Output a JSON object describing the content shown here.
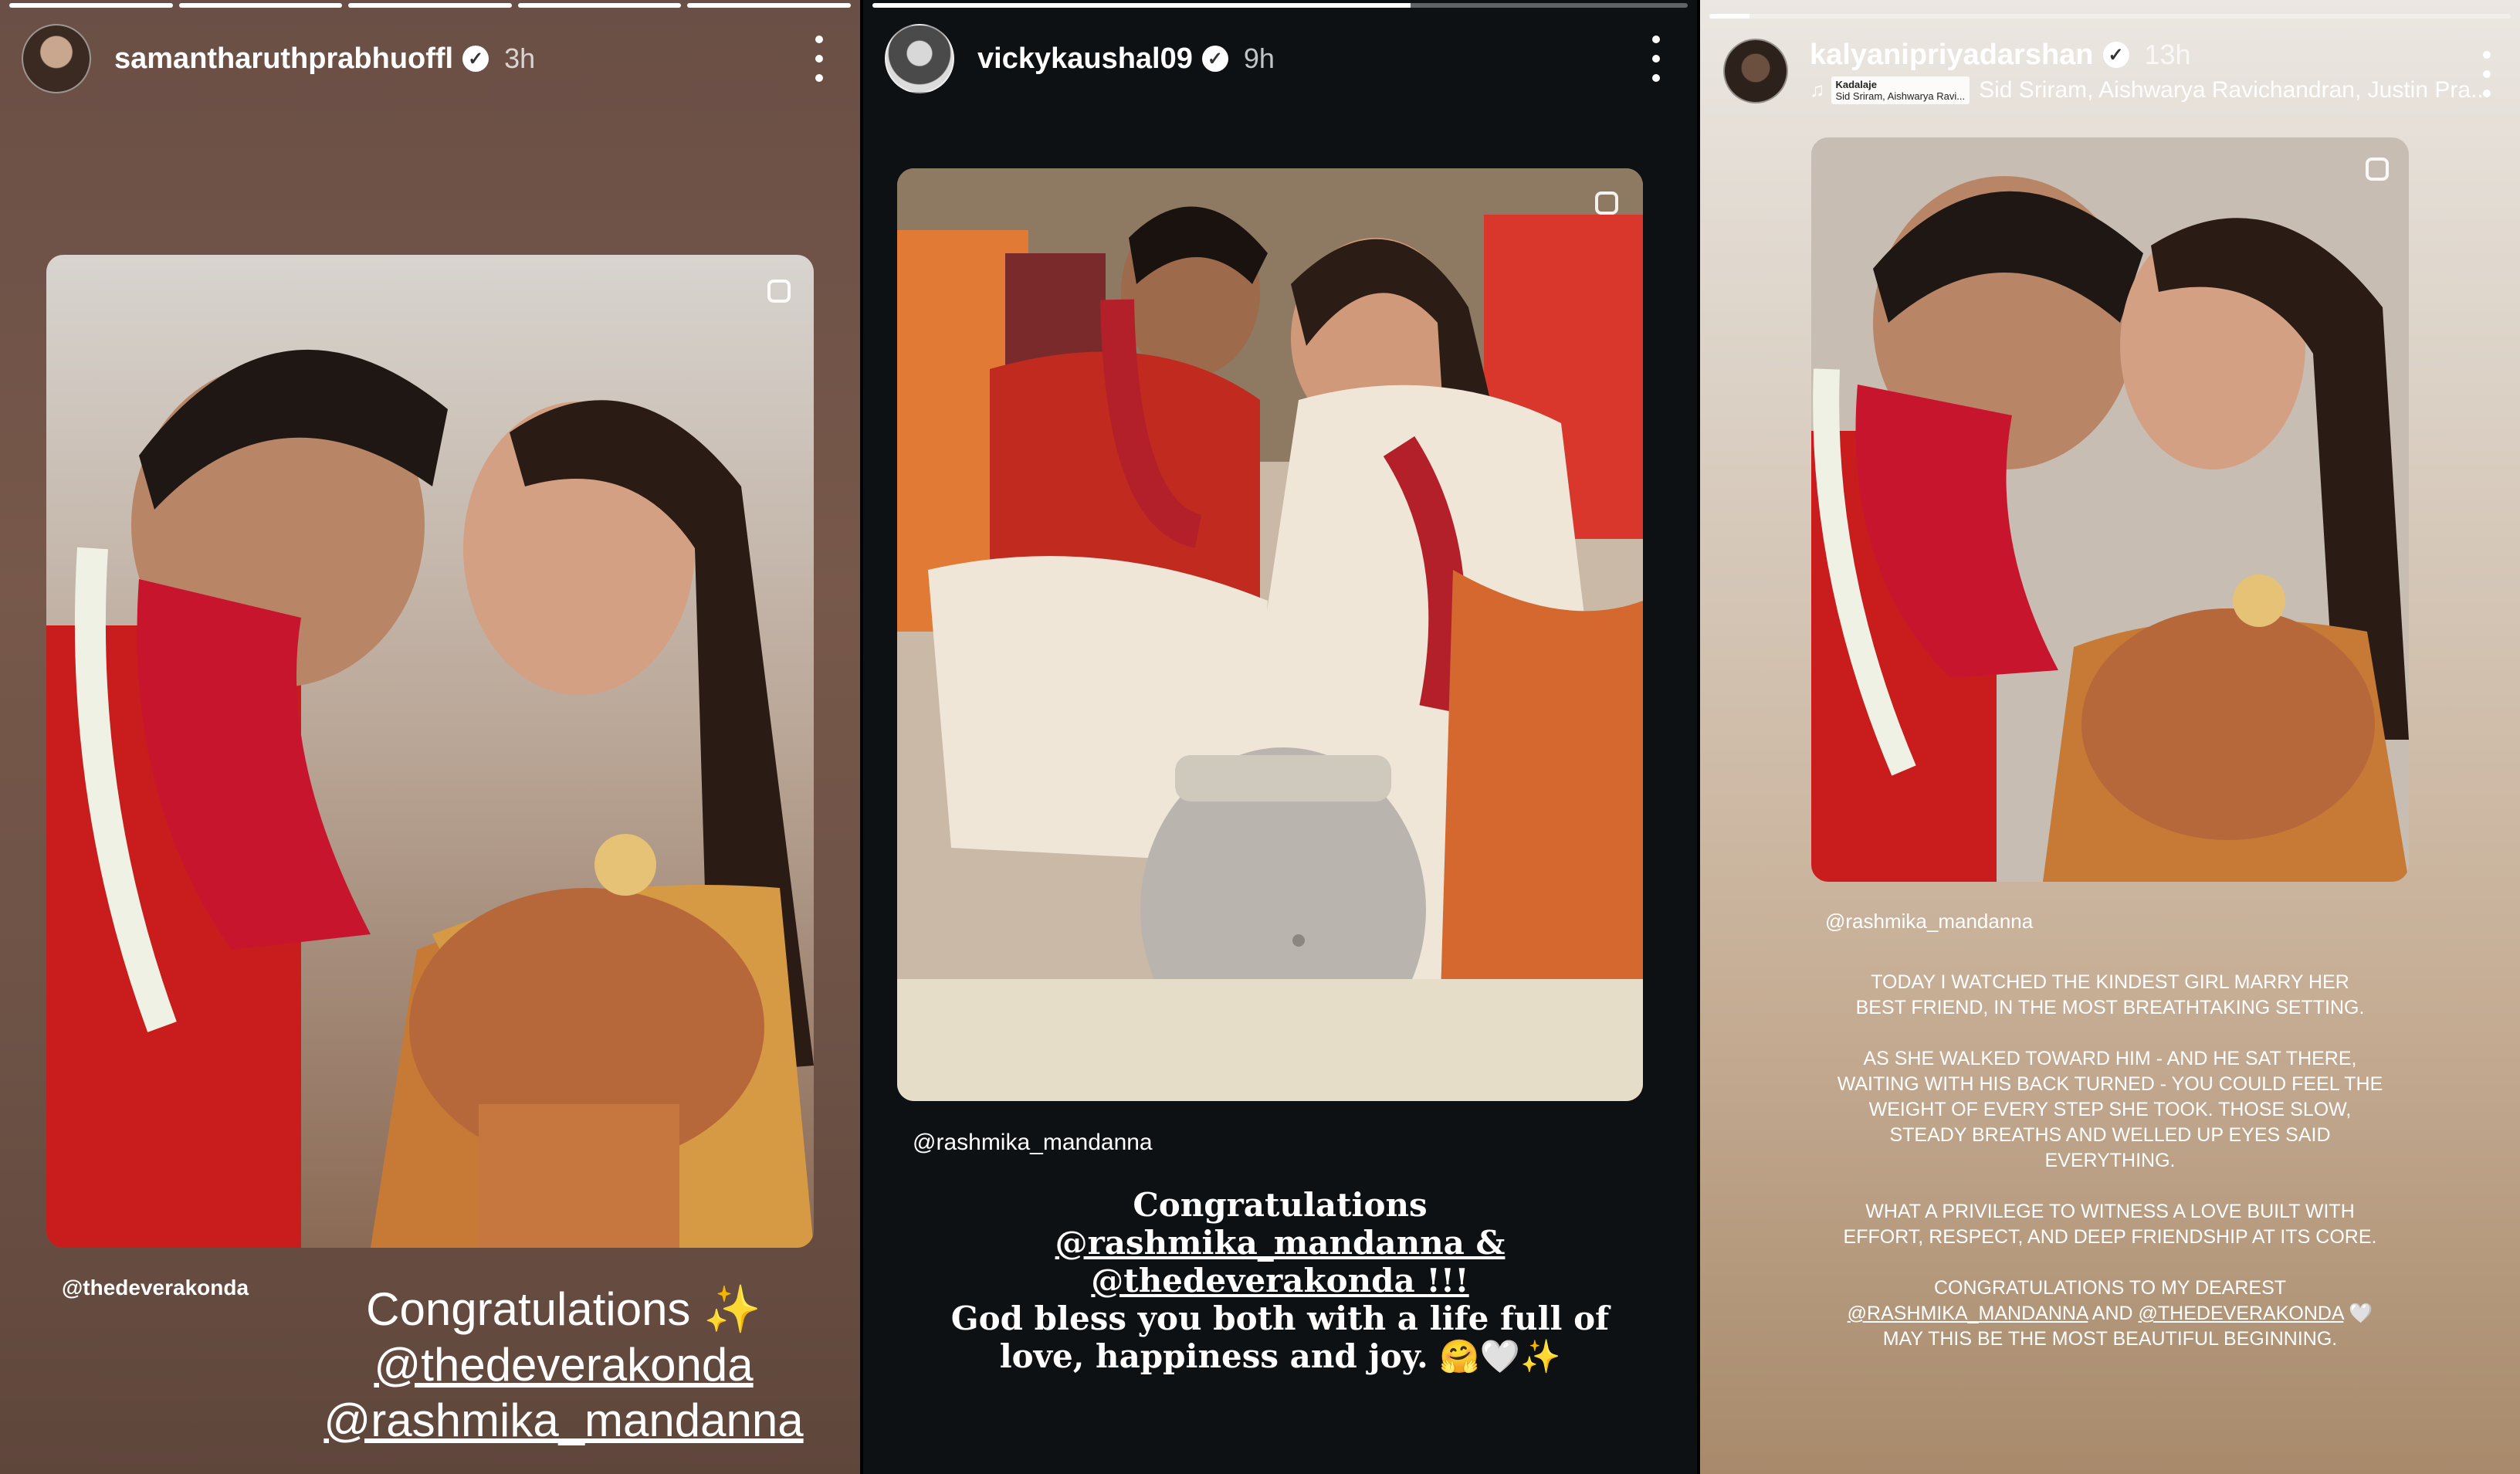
{
  "stories": [
    {
      "username": "samantharuthprabhuoffl",
      "time": "3h",
      "tag": "@thedeverakonda",
      "caption": {
        "line1": "Congratulations ✨",
        "line2": "@thedeverakonda",
        "line3": "@rashmika_mandanna"
      },
      "progress": [
        1,
        1,
        1,
        1,
        1
      ],
      "colors": {
        "background": "#6a4f46"
      }
    },
    {
      "username": "vickykaushal09",
      "time": "9h",
      "tag": "@rashmika_mandanna",
      "caption": {
        "line1": "Congratulations",
        "line2": "@rashmika_mandanna &",
        "line3": "@thedeverakonda !!!",
        "line4": "God bless you both with a life full of",
        "line5": "love, happiness and joy. 🤗🤍✨"
      },
      "progress": [
        0.66
      ],
      "colors": {
        "background": "#0d1114"
      }
    },
    {
      "username": "kalyanipriyadarshan",
      "time": "13h",
      "music": "Sid Sriram, Aishwarya Ravichandran, Justin Pra...",
      "music_badge": "Kadalaje",
      "music_badge_sub": "Sid Sriram, Aishwarya Ravi...",
      "tag": "@rashmika_mandanna",
      "caption": {
        "p1": "TODAY I WATCHED THE KINDEST GIRL MARRY HER BEST FRIEND, IN THE MOST BREATHTAKING SETTING.",
        "p2": "AS SHE WALKED TOWARD HIM - AND HE SAT THERE, WAITING WITH HIS BACK TURNED - YOU COULD FEEL THE WEIGHT OF EVERY STEP SHE TOOK. THOSE SLOW, STEADY BREATHS AND WELLED UP EYES SAID EVERYTHING.",
        "p3": "WHAT A PRIVILEGE TO WITNESS A LOVE BUILT WITH EFFORT, RESPECT, AND DEEP FRIENDSHIP AT ITS CORE.",
        "p4_a": "CONGRATULATIONS TO MY DEAREST",
        "p4_m1": "@RASHMIKA_MANDANNA",
        "p4_and": " AND ",
        "p4_m2": "@THEDEVERAKONDA",
        "p4_heart": " 🤍",
        "p4_b": "MAY THIS BE THE MOST BEAUTIFUL BEGINNING."
      },
      "progress": [
        0.05
      ],
      "colors": {
        "background": "#d9cec1"
      }
    }
  ]
}
